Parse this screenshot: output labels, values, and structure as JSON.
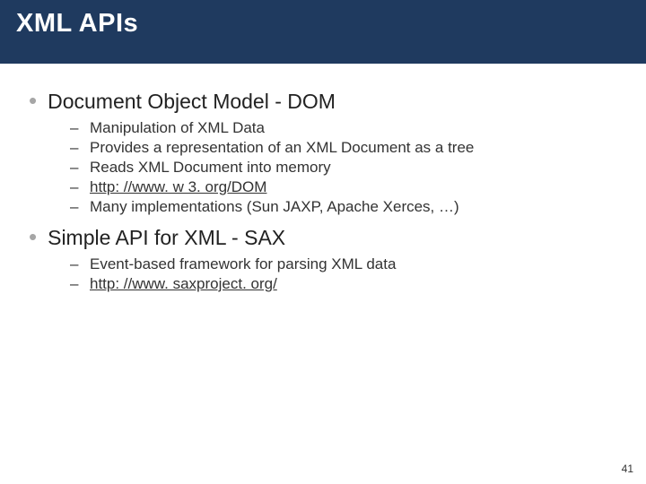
{
  "title": "XML APIs",
  "sections": [
    {
      "heading": "Document Object Model - DOM",
      "items": [
        {
          "text": "Manipulation of XML Data",
          "link": false
        },
        {
          "text": "Provides a representation of an XML Document as a tree",
          "link": false
        },
        {
          "text": "Reads XML Document into memory",
          "link": false
        },
        {
          "text": "http: //www. w 3. org/DOM",
          "link": true
        },
        {
          "text": "Many implementations (Sun JAXP, Apache Xerces, …)",
          "link": false
        }
      ]
    },
    {
      "heading": "Simple API for XML - SAX",
      "items": [
        {
          "text": "Event-based framework for parsing XML data",
          "link": false
        },
        {
          "text": "http: //www. saxproject. org/",
          "link": true
        }
      ]
    }
  ],
  "page_number": "41",
  "colors": {
    "title_bg": "#1f3a5f",
    "bullet": "#a6a6a6"
  }
}
